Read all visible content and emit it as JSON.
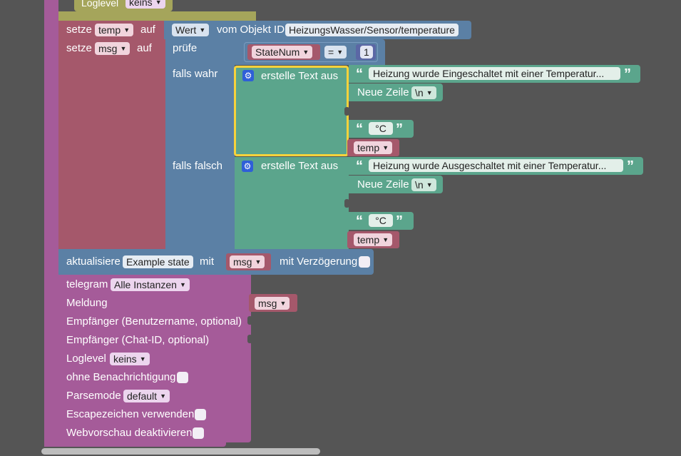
{
  "colors": {
    "purple": "#a55b99",
    "pink": "#a5586b",
    "blue": "#5b80a5",
    "green": "#5ba58c",
    "selection": "#f7d23b"
  },
  "top_block": {
    "loglevel_label": "Loglevel",
    "loglevel_value": "keins"
  },
  "set_temp": {
    "prefix": "setze",
    "var": "temp",
    "suffix": "auf",
    "value_type": "Wert",
    "of_object": "vom Objekt ID",
    "object_id": "HeizungsWasser/Sensor/temperature"
  },
  "set_msg": {
    "prefix": "setze",
    "var": "msg",
    "suffix": "auf",
    "check": "prüfe",
    "compare_var": "StateNum",
    "operator": "=",
    "compare_value": "1",
    "if_true": "falls wahr",
    "if_false": "falls falsch",
    "create_text": "erstelle Text aus",
    "text_true": "Heizung wurde Eingeschaltet mit einer Temperatur...",
    "text_false": "Heizung wurde Ausgeschaltet mit einer Temperatur...",
    "newline_label": "Neue Zeile",
    "newline_value": "\\n",
    "degree": "°C",
    "temp_var": "temp"
  },
  "update": {
    "label": "aktualisiere",
    "state": "Example state",
    "with": "mit",
    "var": "msg",
    "delay": "mit Verzögerung"
  },
  "telegram": {
    "label": "telegram",
    "instances": "Alle Instanzen",
    "message": "Meldung",
    "message_var": "msg",
    "recipient_user": "Empfänger (Benutzername, optional)",
    "recipient_chat": "Empfänger (Chat-ID, optional)",
    "loglevel_label": "Loglevel",
    "loglevel_value": "keins",
    "silent": "ohne Benachrichtigung",
    "parsemode_label": "Parsemode",
    "parsemode_value": "default",
    "escape": "Escapezeichen verwenden",
    "webpreview": "Webvorschau deaktivieren"
  }
}
